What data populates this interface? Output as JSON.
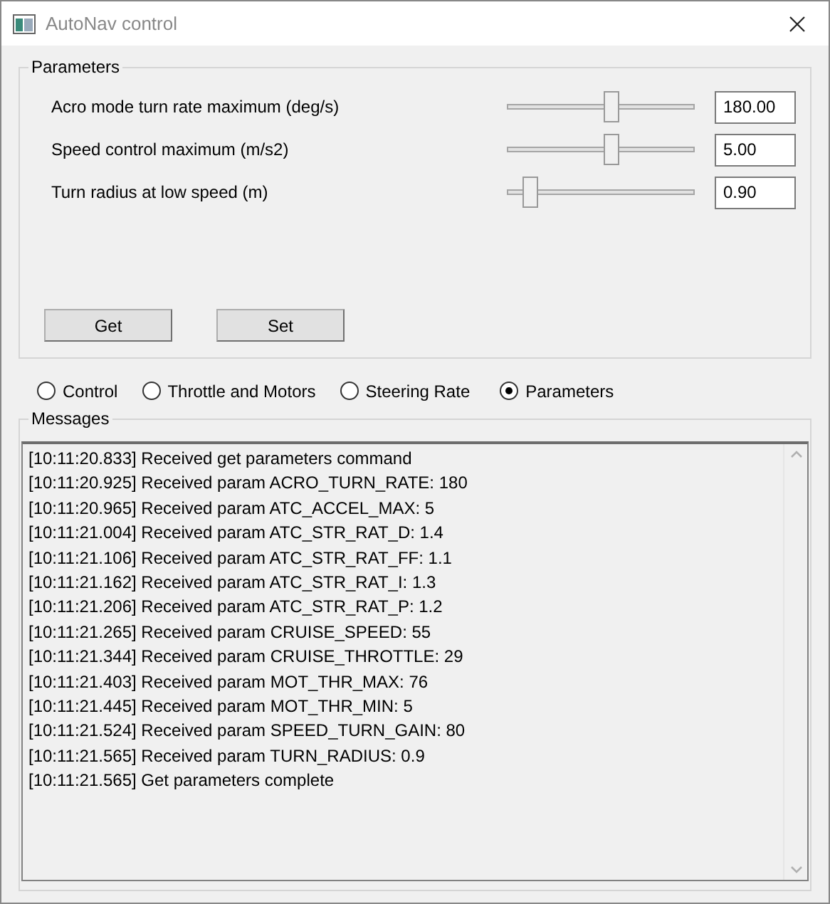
{
  "window": {
    "title": "AutoNav control"
  },
  "parameters": {
    "title": "Parameters",
    "rows": [
      {
        "label": "Acro mode turn rate maximum (deg/s)",
        "level": 0.55,
        "value": "180.00"
      },
      {
        "label": "Speed control maximum (m/s2)",
        "level": 0.55,
        "value": "5.00"
      },
      {
        "label": "Turn radius at low speed (m)",
        "level": 0.12,
        "value": "0.90"
      }
    ],
    "buttons": [
      "Get",
      "Set"
    ]
  },
  "modes": [
    {
      "label": "Control",
      "selected": false
    },
    {
      "label": "Throttle and Motors",
      "selected": false
    },
    {
      "label": "Steering Rate",
      "selected": false
    },
    {
      "label": "Parameters",
      "selected": true
    }
  ],
  "messages": {
    "title": "Messages",
    "lines": [
      "[10:11:20.833] Received get parameters command",
      "[10:11:20.925] Received param ACRO_TURN_RATE: 180",
      "[10:11:20.965] Received param ATC_ACCEL_MAX: 5",
      "[10:11:21.004] Received param ATC_STR_RAT_D: 1.4",
      "[10:11:21.106] Received param ATC_STR_RAT_FF: 1.1",
      "[10:11:21.162] Received param ATC_STR_RAT_I: 1.3",
      "[10:11:21.206] Received param ATC_STR_RAT_P: 1.2",
      "[10:11:21.265] Received param CRUISE_SPEED: 55",
      "[10:11:21.344] Received param CRUISE_THROTTLE: 29",
      "[10:11:21.403] Received param MOT_THR_MAX: 76",
      "[10:11:21.445] Received param MOT_THR_MIN: 5",
      "[10:11:21.524] Received param SPEED_TURN_GAIN: 80",
      "[10:11:21.565] Received param TURN_RADIUS: 0.9",
      "[10:11:21.565] Get parameters complete"
    ]
  }
}
